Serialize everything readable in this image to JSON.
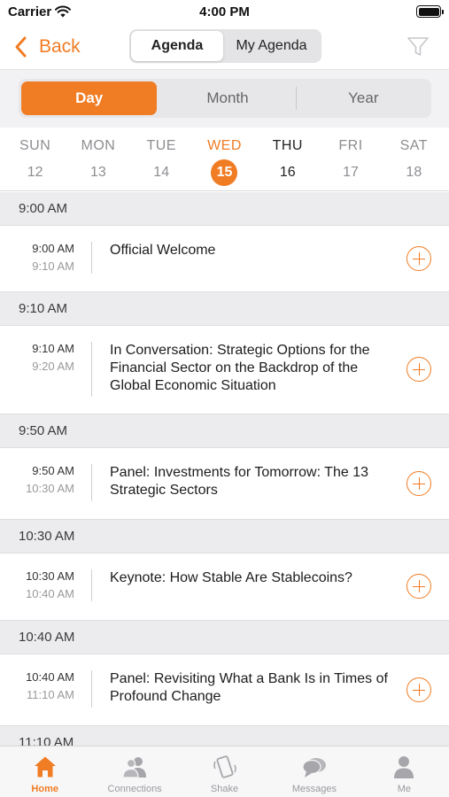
{
  "status": {
    "carrier": "Carrier",
    "time": "4:00 PM"
  },
  "nav": {
    "back_label": "Back",
    "segments": [
      {
        "label": "Agenda",
        "active": true
      },
      {
        "label": "My Agenda",
        "active": false
      }
    ]
  },
  "range": {
    "options": [
      {
        "label": "Day",
        "active": true
      },
      {
        "label": "Month",
        "active": false
      },
      {
        "label": "Year",
        "active": false
      }
    ]
  },
  "week": {
    "days": [
      {
        "name": "SUN",
        "date": "12"
      },
      {
        "name": "MON",
        "date": "13"
      },
      {
        "name": "TUE",
        "date": "14"
      },
      {
        "name": "WED",
        "date": "15"
      },
      {
        "name": "THU",
        "date": "16"
      },
      {
        "name": "FRI",
        "date": "17"
      },
      {
        "name": "SAT",
        "date": "18"
      }
    ]
  },
  "agenda": {
    "sections": [
      {
        "header": "9:00 AM",
        "start": "9:00 AM",
        "end": "9:10 AM",
        "title": "Official Welcome"
      },
      {
        "header": "9:10 AM",
        "start": "9:10 AM",
        "end": "9:20 AM",
        "title": "In Conversation: Strategic Options for the Financial Sector on the Backdrop of the Global Economic Situation"
      },
      {
        "header": "9:50 AM",
        "start": "9:50 AM",
        "end": "10:30 AM",
        "title": "Panel: Investments for Tomorrow: The 13 Strategic Sectors"
      },
      {
        "header": "10:30 AM",
        "start": "10:30 AM",
        "end": "10:40 AM",
        "title": "Keynote: How Stable Are Stablecoins?"
      },
      {
        "header": "10:40 AM",
        "start": "10:40 AM",
        "end": "11:10 AM",
        "title": "Panel: Revisiting What a Bank Is in Times of Profound Change"
      },
      {
        "header": "11:10 AM"
      }
    ]
  },
  "tabbar": {
    "tabs": [
      {
        "label": "Home",
        "icon": "home-icon"
      },
      {
        "label": "Connections",
        "icon": "connections-icon"
      },
      {
        "label": "Shake",
        "icon": "shake-icon"
      },
      {
        "label": "Messages",
        "icon": "messages-icon"
      },
      {
        "label": "Me",
        "icon": "me-icon"
      }
    ]
  },
  "colors": {
    "accent": "#f07c24",
    "muted": "#8e8e93",
    "section_bg": "#ececee"
  }
}
